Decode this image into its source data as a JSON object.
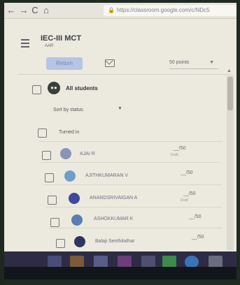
{
  "browser": {
    "back_icon": "back-arrow-icon",
    "forward_icon": "forward-arrow-icon",
    "url": "https://classroom.google.com/c/NDc5",
    "back": "←",
    "forward": "→",
    "reload": "C",
    "home": "⌂"
  },
  "header": {
    "class_title": "IEC-III MCT",
    "class_subtitle": "AAR"
  },
  "toolbar": {
    "return_label": "Return",
    "points_label": "50 points"
  },
  "list": {
    "all_students_label": "All students",
    "sort_label": "Sort by status",
    "section_label": "Turned in",
    "students": [
      {
        "name": "AJAI R",
        "grade": "__/50",
        "grade_sub": "Draft"
      },
      {
        "name": "AJITHKUMARAN V",
        "grade": "__/50",
        "grade_sub": ""
      },
      {
        "name": "ANANDSRIVAIGAN A",
        "grade": "__/50",
        "grade_sub": "Draft"
      },
      {
        "name": "ASHOKKUMAR K",
        "grade": "__/50",
        "grade_sub": ""
      },
      {
        "name": "Balaji Senthilathar",
        "grade": "__/50",
        "grade_sub": ""
      }
    ]
  },
  "colors": {
    "accent": "#b8c4e4",
    "taskbar": "#2d2c44"
  }
}
